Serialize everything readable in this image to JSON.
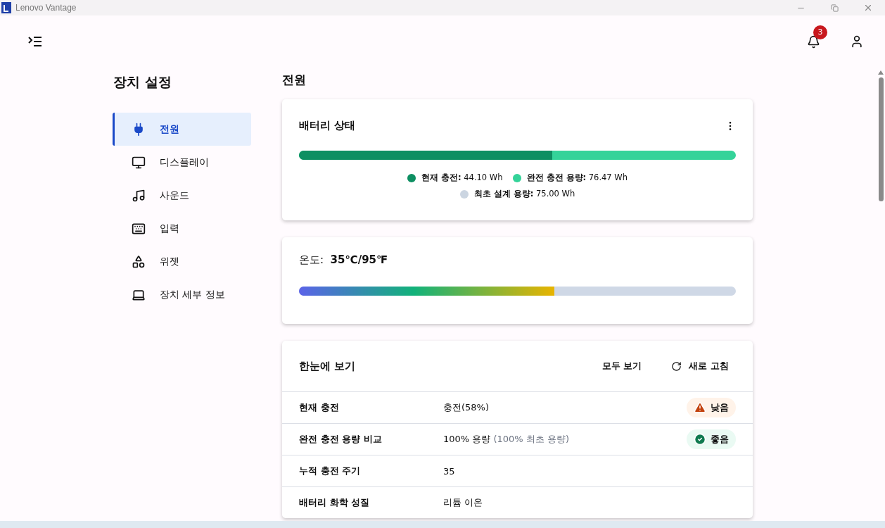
{
  "window": {
    "title": "Lenovo Vantage"
  },
  "header": {
    "notification_count": "3"
  },
  "sidebar": {
    "title": "장치 설정",
    "items": [
      {
        "label": "전원",
        "kind": "power",
        "selected": true
      },
      {
        "label": "디스플레이",
        "kind": "display",
        "selected": false
      },
      {
        "label": "사운드",
        "kind": "sound",
        "selected": false
      },
      {
        "label": "입력",
        "kind": "input",
        "selected": false
      },
      {
        "label": "위젯",
        "kind": "widgets",
        "selected": false
      },
      {
        "label": "장치 세부 정보",
        "kind": "device",
        "selected": false
      }
    ]
  },
  "page_title": "전원",
  "battery_card": {
    "title": "배터리 상태",
    "level": 0.58,
    "legend": [
      {
        "label": "현재 충전:",
        "value": "44.10 Wh",
        "color": "#0e8f62"
      },
      {
        "label": "완전 충전 용량:",
        "value": "76.47 Wh",
        "color": "#34d399"
      },
      {
        "label": "최초 설계 용량:",
        "value": "75.00 Wh",
        "color": "#cbd5e1"
      }
    ]
  },
  "temperature_card": {
    "label": "온도:",
    "value": "35℃/95℉",
    "level": 0.585
  },
  "overview_card": {
    "title": "한눈에 보기",
    "view_all": "모두 보기",
    "refresh": "새로 고침",
    "rows": [
      {
        "name": "현재 충전",
        "value": "충전(58%)",
        "status": {
          "kind": "low",
          "label": "낮음"
        }
      },
      {
        "name": "완전 충전 용량 비교",
        "value": "100% 용량",
        "note": "(100% 최초 용량)",
        "status": {
          "kind": "good",
          "label": "좋음"
        }
      },
      {
        "name": "누적 충전 주기",
        "value": "35"
      },
      {
        "name": "배터리 화학 성질",
        "value": "리튬 이온"
      }
    ]
  }
}
